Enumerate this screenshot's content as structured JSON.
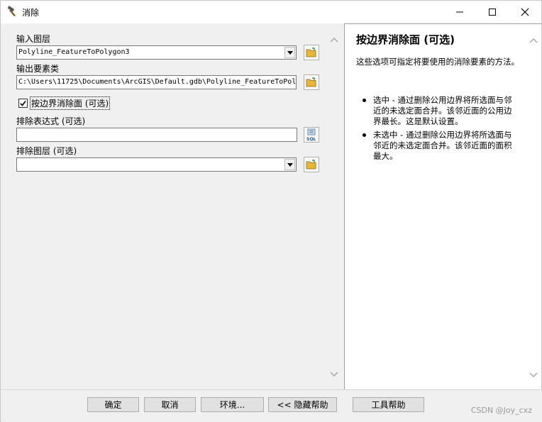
{
  "window": {
    "title": "消除"
  },
  "form": {
    "input_layer_label": "输入图层",
    "input_layer_value": "Polyline_FeatureToPolygon3",
    "output_label": "输出要素类",
    "output_value": "C:\\Users\\11725\\Documents\\ArcGIS\\Default.gdb\\Polyline_FeatureToPol",
    "checkbox_label": "按边界消除面 (可选)",
    "checkbox_checked": true,
    "exclusion_expr_label": "排除表达式 (可选)",
    "exclusion_expr_value": "",
    "exclusion_layer_label": "排除图层 (可选)",
    "exclusion_layer_value": ""
  },
  "help": {
    "title": "按边界消除面 (可选)",
    "intro": "这些选项可指定将要使用的消除要素的方法。",
    "bullets": [
      "选中 - 通过删除公用边界将所选面与邻近的未选定面合并。该邻近面的公用边界最长。这是默认设置。",
      "未选中 - 通过删除公用边界将所选面与邻近的未选定面合并。该邻近面的面积最大。"
    ]
  },
  "buttons": {
    "ok": "确定",
    "cancel": "取消",
    "environments": "环境...",
    "hide_help": "<< 隐藏帮助",
    "tool_help": "工具帮助"
  },
  "watermark": "CSDN @Joy_cxz",
  "icons": {
    "title": "hammer-icon",
    "browse": "folder-open-icon",
    "sql": "sql-icon"
  },
  "colors": {
    "panel": "#f0f0f0",
    "help_bg": "#ffffff",
    "button": "#e1e1e1",
    "folder_yellow": "#e8b63a"
  }
}
